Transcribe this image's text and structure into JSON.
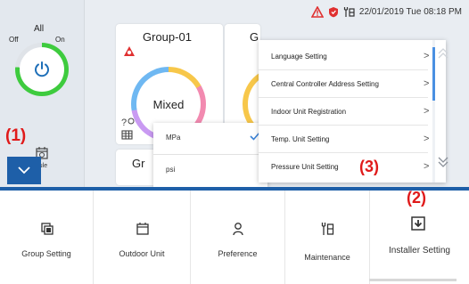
{
  "status": {
    "datetime": "22/01/2019 Tue 08:18 PM",
    "icons": [
      "alert-triangle-icon",
      "shield-icon",
      "wrench-icon"
    ]
  },
  "master_control": {
    "label": "All",
    "off_label": "Off",
    "on_label": "On",
    "power_state": "on"
  },
  "left_nav": {
    "schedule_label": "edule",
    "collapse_icon": "chevron-down-icon"
  },
  "groups": [
    {
      "name": "Group-01",
      "mode": "Mixed"
    },
    {
      "name": "G"
    },
    {
      "name": "Gr"
    }
  ],
  "unit_popup": {
    "options": [
      {
        "label": "MPa",
        "selected": true
      },
      {
        "label": "psi",
        "selected": false
      }
    ]
  },
  "settings_menu": {
    "items": [
      {
        "label": "Language Setting"
      },
      {
        "label": "Central Controller Address Setting"
      },
      {
        "label": "Indoor Unit Registration"
      },
      {
        "label": "Temp. Unit Setting"
      },
      {
        "label": "Pressure Unit Setting"
      }
    ],
    "chevron": ">"
  },
  "markers": {
    "m1": "(1)",
    "m2": "(2)",
    "m3": "(3)"
  },
  "bottom_menu": [
    {
      "label": "Group Setting",
      "icon": "group-setting-icon"
    },
    {
      "label": "Outdoor Unit",
      "icon": "outdoor-unit-icon"
    },
    {
      "label": "Preference",
      "icon": "preference-icon"
    },
    {
      "label": "Maintenance",
      "icon": "maintenance-icon"
    },
    {
      "label": "Installer Setting",
      "icon": "installer-setting-icon",
      "selected": true
    }
  ],
  "colors": {
    "accent_blue": "#1e5fa8",
    "power_green": "#3ecb3e",
    "marker_red": "#e01a1a",
    "warning_red": "#e03030"
  }
}
